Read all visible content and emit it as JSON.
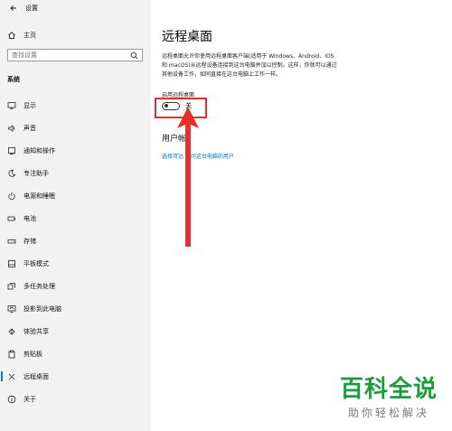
{
  "window": {
    "title": "设置"
  },
  "sidebar": {
    "home_label": "主页",
    "search_placeholder": "查找设置",
    "section_label": "系统",
    "items": [
      {
        "label": "显示",
        "icon": "display-icon"
      },
      {
        "label": "声音",
        "icon": "sound-icon"
      },
      {
        "label": "通知和操作",
        "icon": "notification-icon"
      },
      {
        "label": "专注助手",
        "icon": "focus-moon-icon"
      },
      {
        "label": "电源和睡眠",
        "icon": "power-icon"
      },
      {
        "label": "电池",
        "icon": "battery-icon"
      },
      {
        "label": "存储",
        "icon": "storage-icon"
      },
      {
        "label": "平板模式",
        "icon": "tablet-icon"
      },
      {
        "label": "多任务处理",
        "icon": "multitask-icon"
      },
      {
        "label": "投影到此电脑",
        "icon": "project-icon"
      },
      {
        "label": "体验共享",
        "icon": "share-icon"
      },
      {
        "label": "剪贴板",
        "icon": "clipboard-icon"
      },
      {
        "label": "远程桌面",
        "icon": "remote-desktop-icon",
        "active": true
      },
      {
        "label": "关于",
        "icon": "info-icon"
      }
    ],
    "accent_color": "#0078d7"
  },
  "main": {
    "title": "远程桌面",
    "description_lines": [
      "远程桌面允许你使用远程桌面客户端(适用于 Windows、Android、iOS",
      "和 macOS)从远程设备连接到这台电脑并加以控制。这样，你就可以通过",
      "其他设备工作，如同直接在这台电脑上工作一样。"
    ],
    "toggle": {
      "label": "启用远程桌面",
      "state_text": "关",
      "on": false
    },
    "users_heading": "用户帐",
    "users_link": "选择可远 访问这台电脑的用户",
    "link_color": "#0067c0",
    "highlight_color": "#e5312a"
  },
  "watermark": {
    "main": "百科全说",
    "sub": "助你轻松解决",
    "color": "#1e9b3f"
  }
}
